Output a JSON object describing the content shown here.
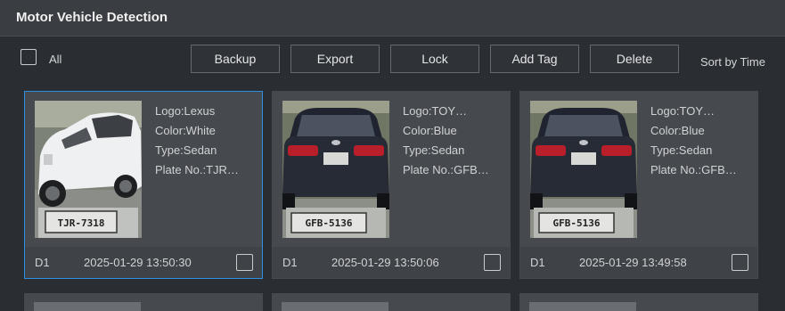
{
  "window": {
    "title": "Motor Vehicle Detection"
  },
  "toolbar": {
    "all_label": "All",
    "buttons": [
      "Backup",
      "Export",
      "Lock",
      "Add Tag",
      "Delete"
    ],
    "sort_label": "Sort by Time"
  },
  "cards": [
    {
      "logo": "Logo:Lexus",
      "color": "Color:White",
      "type": "Type:Sedan",
      "plate": "Plate No.:TJR…",
      "plate_image_text": "TJR-7318",
      "channel": "D1",
      "timestamp": "2025-01-29 13:50:30",
      "car_color": "#e8e9ea",
      "selected": true
    },
    {
      "logo": "Logo:TOY…",
      "color": "Color:Blue",
      "type": "Type:Sedan",
      "plate": "Plate No.:GFB…",
      "plate_image_text": "GFB-5136",
      "channel": "D1",
      "timestamp": "2025-01-29 13:50:06",
      "car_color": "#262b36",
      "selected": false
    },
    {
      "logo": "Logo:TOY…",
      "color": "Color:Blue",
      "type": "Type:Sedan",
      "plate": "Plate No.:GFB…",
      "plate_image_text": "GFB-5136",
      "channel": "D1",
      "timestamp": "2025-01-29 13:49:58",
      "car_color": "#262b36",
      "selected": false
    }
  ],
  "colors": {
    "background": "#2a2d31",
    "card": "#46494e",
    "selected_border": "#2e8fe0"
  }
}
